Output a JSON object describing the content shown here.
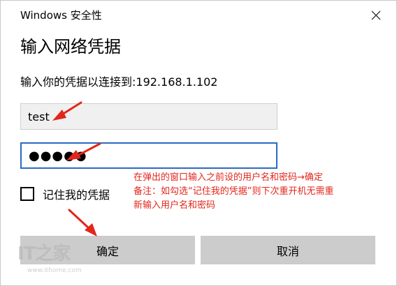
{
  "window": {
    "title": "Windows 安全性",
    "close_icon": "close-icon"
  },
  "dialog": {
    "heading": "输入网络凭据",
    "prompt": "输入你的凭据以连接到:192.168.1.102"
  },
  "username": {
    "value": "test"
  },
  "password": {
    "masked_value": "●●●●●"
  },
  "remember": {
    "label": "记住我的凭据",
    "checked": false
  },
  "buttons": {
    "ok_label": "确定",
    "cancel_label": "取消"
  },
  "annotation": {
    "line1": "在弹出的窗口输入之前设的用户名和密码→确定",
    "line2": "备注：如勾选“记住我的凭据”则下次重开机无需重",
    "line3": "新输入用户名和密码",
    "color": "#e2261b"
  },
  "watermark": {
    "logo": "IT之家",
    "url": "www.ithome.com"
  },
  "colors": {
    "accent_border": "#2b6ac3",
    "button_bg": "#cccccc",
    "arrow": "#e2261b"
  }
}
